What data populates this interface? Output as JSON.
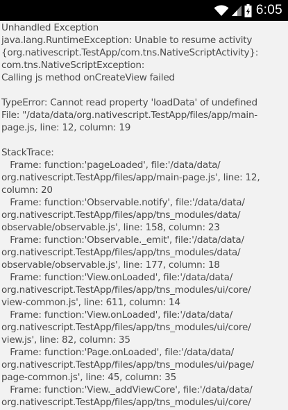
{
  "status_bar": {
    "time": "6:05",
    "icons": [
      "wifi-icon",
      "cell-signal-icon",
      "battery-icon"
    ]
  },
  "exception": {
    "lines": [
      "Unhandled Exception",
      "java.lang.RuntimeException: Unable to resume activity",
      "{org.nativescript.TestApp/com.tns.NativeScriptActivity}:",
      "com.tns.NativeScriptException:",
      "Calling js method onCreateView failed",
      "",
      "TypeError: Cannot read property 'loadData' of undefined",
      "File: \"/data/data/org.nativescript.TestApp/files/app/main-",
      "page.js, line: 12, column: 19",
      "",
      "StackTrace:",
      "   Frame: function:'pageLoaded', file:'/data/data/",
      "org.nativescript.TestApp/files/app/main-page.js', line: 12,",
      "column: 20",
      "   Frame: function:'Observable.notify', file:'/data/data/",
      "org.nativescript.TestApp/files/app/tns_modules/data/",
      "observable/observable.js', line: 158, column: 23",
      "   Frame: function:'Observable._emit', file:'/data/data/",
      "org.nativescript.TestApp/files/app/tns_modules/data/",
      "observable/observable.js', line: 177, column: 18",
      "   Frame: function:'View.onLoaded', file:'/data/data/",
      "org.nativescript.TestApp/files/app/tns_modules/ui/core/",
      "view-common.js', line: 611, column: 14",
      "   Frame: function:'View.onLoaded', file:'/data/data/",
      "org.nativescript.TestApp/files/app/tns_modules/ui/core/",
      "view.js', line: 82, column: 35",
      "   Frame: function:'Page.onLoaded', file:'/data/data/",
      "org.nativescript.TestApp/files/app/tns_modules/ui/page/",
      "page-common.js', line: 45, column: 35",
      "   Frame: function:'View._addViewCore', file:'/data/data/",
      "org.nativescript.TestApp/files/app/tns_modules/ui/core/"
    ]
  }
}
